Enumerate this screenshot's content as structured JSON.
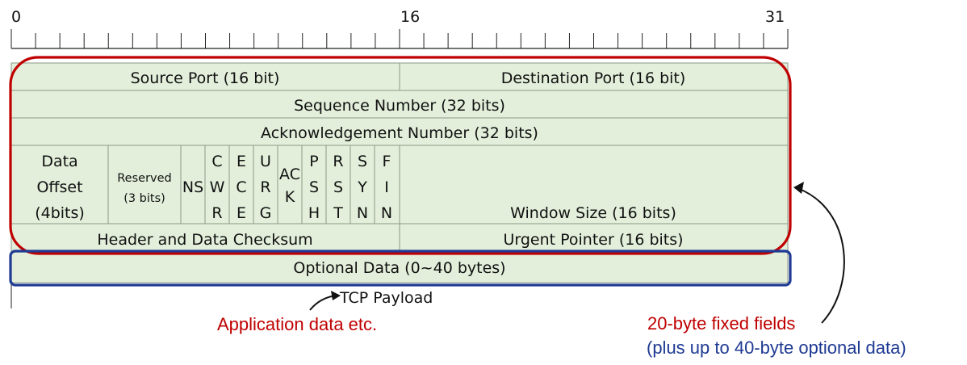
{
  "ruler": {
    "labels": [
      "0",
      "16",
      "31"
    ]
  },
  "rows": {
    "source_port": "Source Port (16 bit)",
    "destination_port": "Destination Port (16 bit)",
    "sequence_number": "Sequence Number (32 bits)",
    "ack_number": "Acknowledgement Number (32 bits)",
    "data_offset": [
      "Data",
      "Offset",
      "(4bits)"
    ],
    "reserved": [
      "Reserved",
      "(3 bits)"
    ],
    "ns": "NS",
    "flags": [
      [
        "C",
        "W",
        "R"
      ],
      [
        "E",
        "C",
        "E"
      ],
      [
        "U",
        "R",
        "G"
      ],
      [
        "AC",
        "K"
      ],
      [
        "P",
        "S",
        "H"
      ],
      [
        "R",
        "S",
        "T"
      ],
      [
        "S",
        "Y",
        "N"
      ],
      [
        "F",
        "I",
        "N"
      ]
    ],
    "window_size": "Window Size (16 bits)",
    "checksum": "Header and Data Checksum",
    "urgent_pointer": "Urgent Pointer (16 bits)",
    "optional_data": "Optional Data (0~40 bytes)"
  },
  "annotations": {
    "tcp_payload": "TCP Payload",
    "application_data": "Application data etc.",
    "fixed_fields": "20-byte fixed fields",
    "optional_note": "(plus up to 40-byte optional data)"
  },
  "colors": {
    "cell_fill": "#e3efdb",
    "cell_border": "#8a9a85",
    "red": "#c00000",
    "blue": "#1f3a93"
  }
}
